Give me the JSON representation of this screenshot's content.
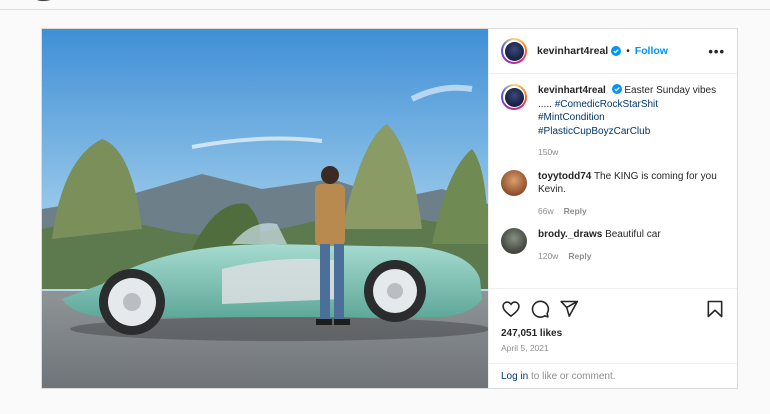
{
  "post": {
    "username": "kevinhart4real",
    "follow_label": "Follow",
    "dot": "•",
    "more_label": "•••",
    "caption": {
      "username": "kevinhart4real",
      "text": "Easter Sunday vibes .....",
      "tags": [
        "#ComedicRockStarShit",
        "#MintCondition",
        "#PlasticCupBoyzCarClub"
      ],
      "age": "150w"
    },
    "comments": [
      {
        "username": "toyytodd74",
        "text": "The KING is coming for you Kevin.",
        "age": "66w",
        "reply_label": "Reply"
      },
      {
        "username": "brody._draws",
        "text": "Beautiful car",
        "age": "120w",
        "reply_label": "Reply"
      }
    ],
    "likes": "247,051 likes",
    "date": "April 5, 2021",
    "login_link": "Log in",
    "login_rest": " to like or comment."
  },
  "colors": {
    "accent": "#0095f6",
    "link": "#00376b",
    "muted": "#8e8e8e",
    "car": "#7fc1b5"
  },
  "icons": [
    "verified-icon",
    "heart-icon",
    "comment-icon",
    "share-icon",
    "bookmark-icon"
  ]
}
